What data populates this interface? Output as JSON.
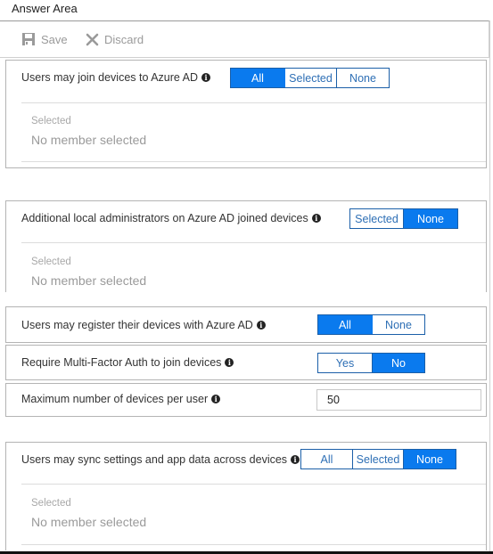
{
  "title": "Answer Area",
  "toolbar": {
    "save_label": "Save",
    "discard_label": "Discard",
    "save_icon": "floppy-disk-icon",
    "discard_icon": "x-icon"
  },
  "colors": {
    "accent": "#0a7aee",
    "accent_border": "#1b5fa8",
    "inactive_text": "#2e6fb5",
    "muted_text": "#9a9a9a"
  },
  "settings": {
    "join_devices": {
      "label": "Users may join devices to Azure AD",
      "info_icon": "info-icon",
      "options": [
        "All",
        "Selected",
        "None"
      ],
      "selected": "All",
      "selected_caption": "Selected",
      "selected_value": "No member selected"
    },
    "local_admins": {
      "label": "Additional local administrators on Azure AD joined devices",
      "info_icon": "info-icon",
      "options": [
        "Selected",
        "None"
      ],
      "selected": "None",
      "selected_caption": "Selected",
      "selected_value": "No member selected"
    },
    "register_devices": {
      "label": "Users may register their devices with Azure AD",
      "info_icon": "info-icon",
      "options": [
        "All",
        "None"
      ],
      "selected": "All"
    },
    "require_mfa": {
      "label": "Require Multi-Factor Auth to join devices",
      "info_icon": "info-icon",
      "options": [
        "Yes",
        "No"
      ],
      "selected": "No"
    },
    "max_devices": {
      "label": "Maximum number of devices per user",
      "info_icon": "info-icon",
      "value": "50"
    },
    "sync_settings": {
      "label": "Users may sync settings and app data across devices",
      "info_icon": "info-icon",
      "options": [
        "All",
        "Selected",
        "None"
      ],
      "selected": "None",
      "selected_caption": "Selected",
      "selected_value": "No member selected"
    }
  }
}
